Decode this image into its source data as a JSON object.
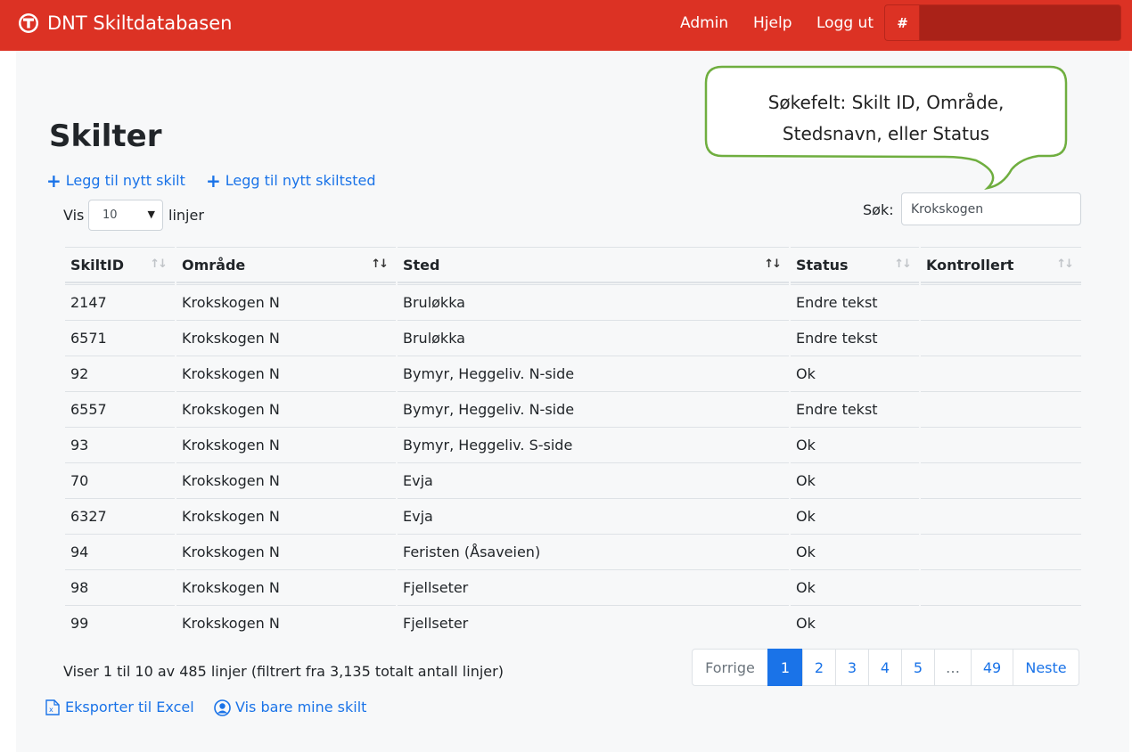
{
  "navbar": {
    "brand": "DNT Skiltdatabasen",
    "links": [
      "Admin",
      "Hjelp",
      "Logg ut"
    ],
    "hash_label": "#",
    "input_value": ""
  },
  "page": {
    "title": "Skilter",
    "add_sign": "Legg til nytt skilt",
    "add_location": "Legg til nytt skiltsted",
    "show_prefix": "Vis",
    "show_value": "10",
    "show_suffix": "linjer",
    "search_label": "Søk:",
    "search_value": "Krokskogen",
    "callout_line1": "Søkefelt: Skilt ID, Område,",
    "callout_line2": "Stedsnavn, eller Status"
  },
  "table": {
    "headers": [
      "SkiltID",
      "Område",
      "Sted",
      "Status",
      "Kontrollert"
    ],
    "rows": [
      [
        "2147",
        "Krokskogen N",
        "Bruløkka",
        "Endre tekst",
        ""
      ],
      [
        "6571",
        "Krokskogen N",
        "Bruløkka",
        "Endre tekst",
        ""
      ],
      [
        "92",
        "Krokskogen N",
        "Bymyr, Heggeliv. N-side",
        "Ok",
        ""
      ],
      [
        "6557",
        "Krokskogen N",
        "Bymyr, Heggeliv. N-side",
        "Endre tekst",
        ""
      ],
      [
        "93",
        "Krokskogen N",
        "Bymyr, Heggeliv. S-side",
        "Ok",
        ""
      ],
      [
        "70",
        "Krokskogen N",
        "Evja",
        "Ok",
        ""
      ],
      [
        "6327",
        "Krokskogen N",
        "Evja",
        "Ok",
        ""
      ],
      [
        "94",
        "Krokskogen N",
        "Feristen (Åsaveien)",
        "Ok",
        ""
      ],
      [
        "98",
        "Krokskogen N",
        "Fjellseter",
        "Ok",
        ""
      ],
      [
        "99",
        "Krokskogen N",
        "Fjellseter",
        "Ok",
        ""
      ]
    ]
  },
  "footer": {
    "info": "Viser 1 til 10 av 485 linjer (filtrert fra 3,135 totalt antall linjer)",
    "pager": [
      "Forrige",
      "1",
      "2",
      "3",
      "4",
      "5",
      "…",
      "49",
      "Neste"
    ],
    "export": "Eksporter til Excel",
    "mine": "Vis bare mine skilt"
  }
}
